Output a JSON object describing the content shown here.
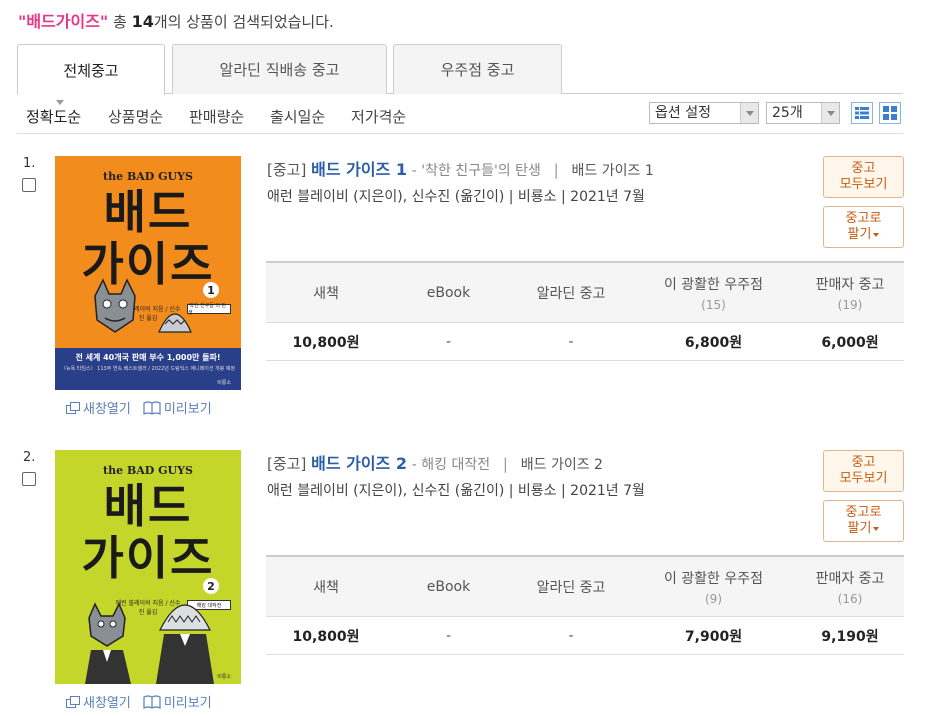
{
  "summary": {
    "keyword": "\"배드가이즈\"",
    "pre": " 총 ",
    "count": "14",
    "post": "개의 상품이 검색되었습니다."
  },
  "tabs": [
    "전체중고",
    "알라딘 직배송 중고",
    "우주점 중고"
  ],
  "sort": [
    "정확도순",
    "상품명순",
    "판매량순",
    "출시일순",
    "저가격순"
  ],
  "controls": {
    "option_label": "옵션 설정",
    "per_page": "25개"
  },
  "colors": {
    "keyword": "#e8358a",
    "title_link": "#2c5ea8",
    "accent_button": "#c65c0f"
  },
  "items": [
    {
      "num": "1.",
      "cover": {
        "brand": "the BAD GUYS",
        "title_l1": "배드",
        "title_l2": "가이즈",
        "vol": "1",
        "sub": "애런 블레이비 지음 / 신수진 옮김",
        "tag": "'착한 친구들'의 탄생",
        "banner1": "전 세계 40개국 판매 부수 1,000만 돌파!",
        "banner2": "〈뉴욕 타임스〉 113주 연속 베스트셀러 / 2022년 드림웍스 애니메이션 개봉 예정",
        "publisher": "비룡소"
      },
      "category": "[중고]",
      "title": "배드 가이즈 1",
      "subtitle": "- '착한 친구들'의 탄생",
      "series_sep": "|",
      "series": "배드 가이즈 1",
      "meta": "애런 블레이비 (지은이), 신수진 (옮긴이) | 비룡소 | 2021년 7월",
      "links": [
        "새창열기",
        "미리보기"
      ],
      "btn_used": [
        "중고",
        "모두보기"
      ],
      "btn_sell": [
        "중고로",
        "팔기"
      ],
      "price_heads": [
        {
          "label": "새책",
          "count": ""
        },
        {
          "label": "eBook",
          "count": ""
        },
        {
          "label": "알라딘 중고",
          "count": ""
        },
        {
          "label": "이 광활한 우주점",
          "count": "(15)"
        },
        {
          "label": "판매자 중고",
          "count": "(19)"
        }
      ],
      "prices": [
        "10,800원",
        "-",
        "-",
        "6,800원",
        "6,000원"
      ]
    },
    {
      "num": "2.",
      "cover": {
        "brand": "the BAD GUYS",
        "title_l1": "배드",
        "title_l2": "가이즈",
        "vol": "2",
        "sub": "애런 블레이비 지음 / 신수진 옮김",
        "tag": "해킹 대작전",
        "banner1": "",
        "banner2": "",
        "publisher": "비룡소"
      },
      "category": "[중고]",
      "title": "배드 가이즈 2",
      "subtitle": "- 해킹 대작전",
      "series_sep": "|",
      "series": "배드 가이즈 2",
      "meta": "애런 블레이비 (지은이), 신수진 (옮긴이) | 비룡소 | 2021년 7월",
      "links": [
        "새창열기",
        "미리보기"
      ],
      "btn_used": [
        "중고",
        "모두보기"
      ],
      "btn_sell": [
        "중고로",
        "팔기"
      ],
      "price_heads": [
        {
          "label": "새책",
          "count": ""
        },
        {
          "label": "eBook",
          "count": ""
        },
        {
          "label": "알라딘 중고",
          "count": ""
        },
        {
          "label": "이 광활한 우주점",
          "count": "(9)"
        },
        {
          "label": "판매자 중고",
          "count": "(16)"
        }
      ],
      "prices": [
        "10,800원",
        "-",
        "-",
        "7,900원",
        "9,190원"
      ]
    }
  ]
}
